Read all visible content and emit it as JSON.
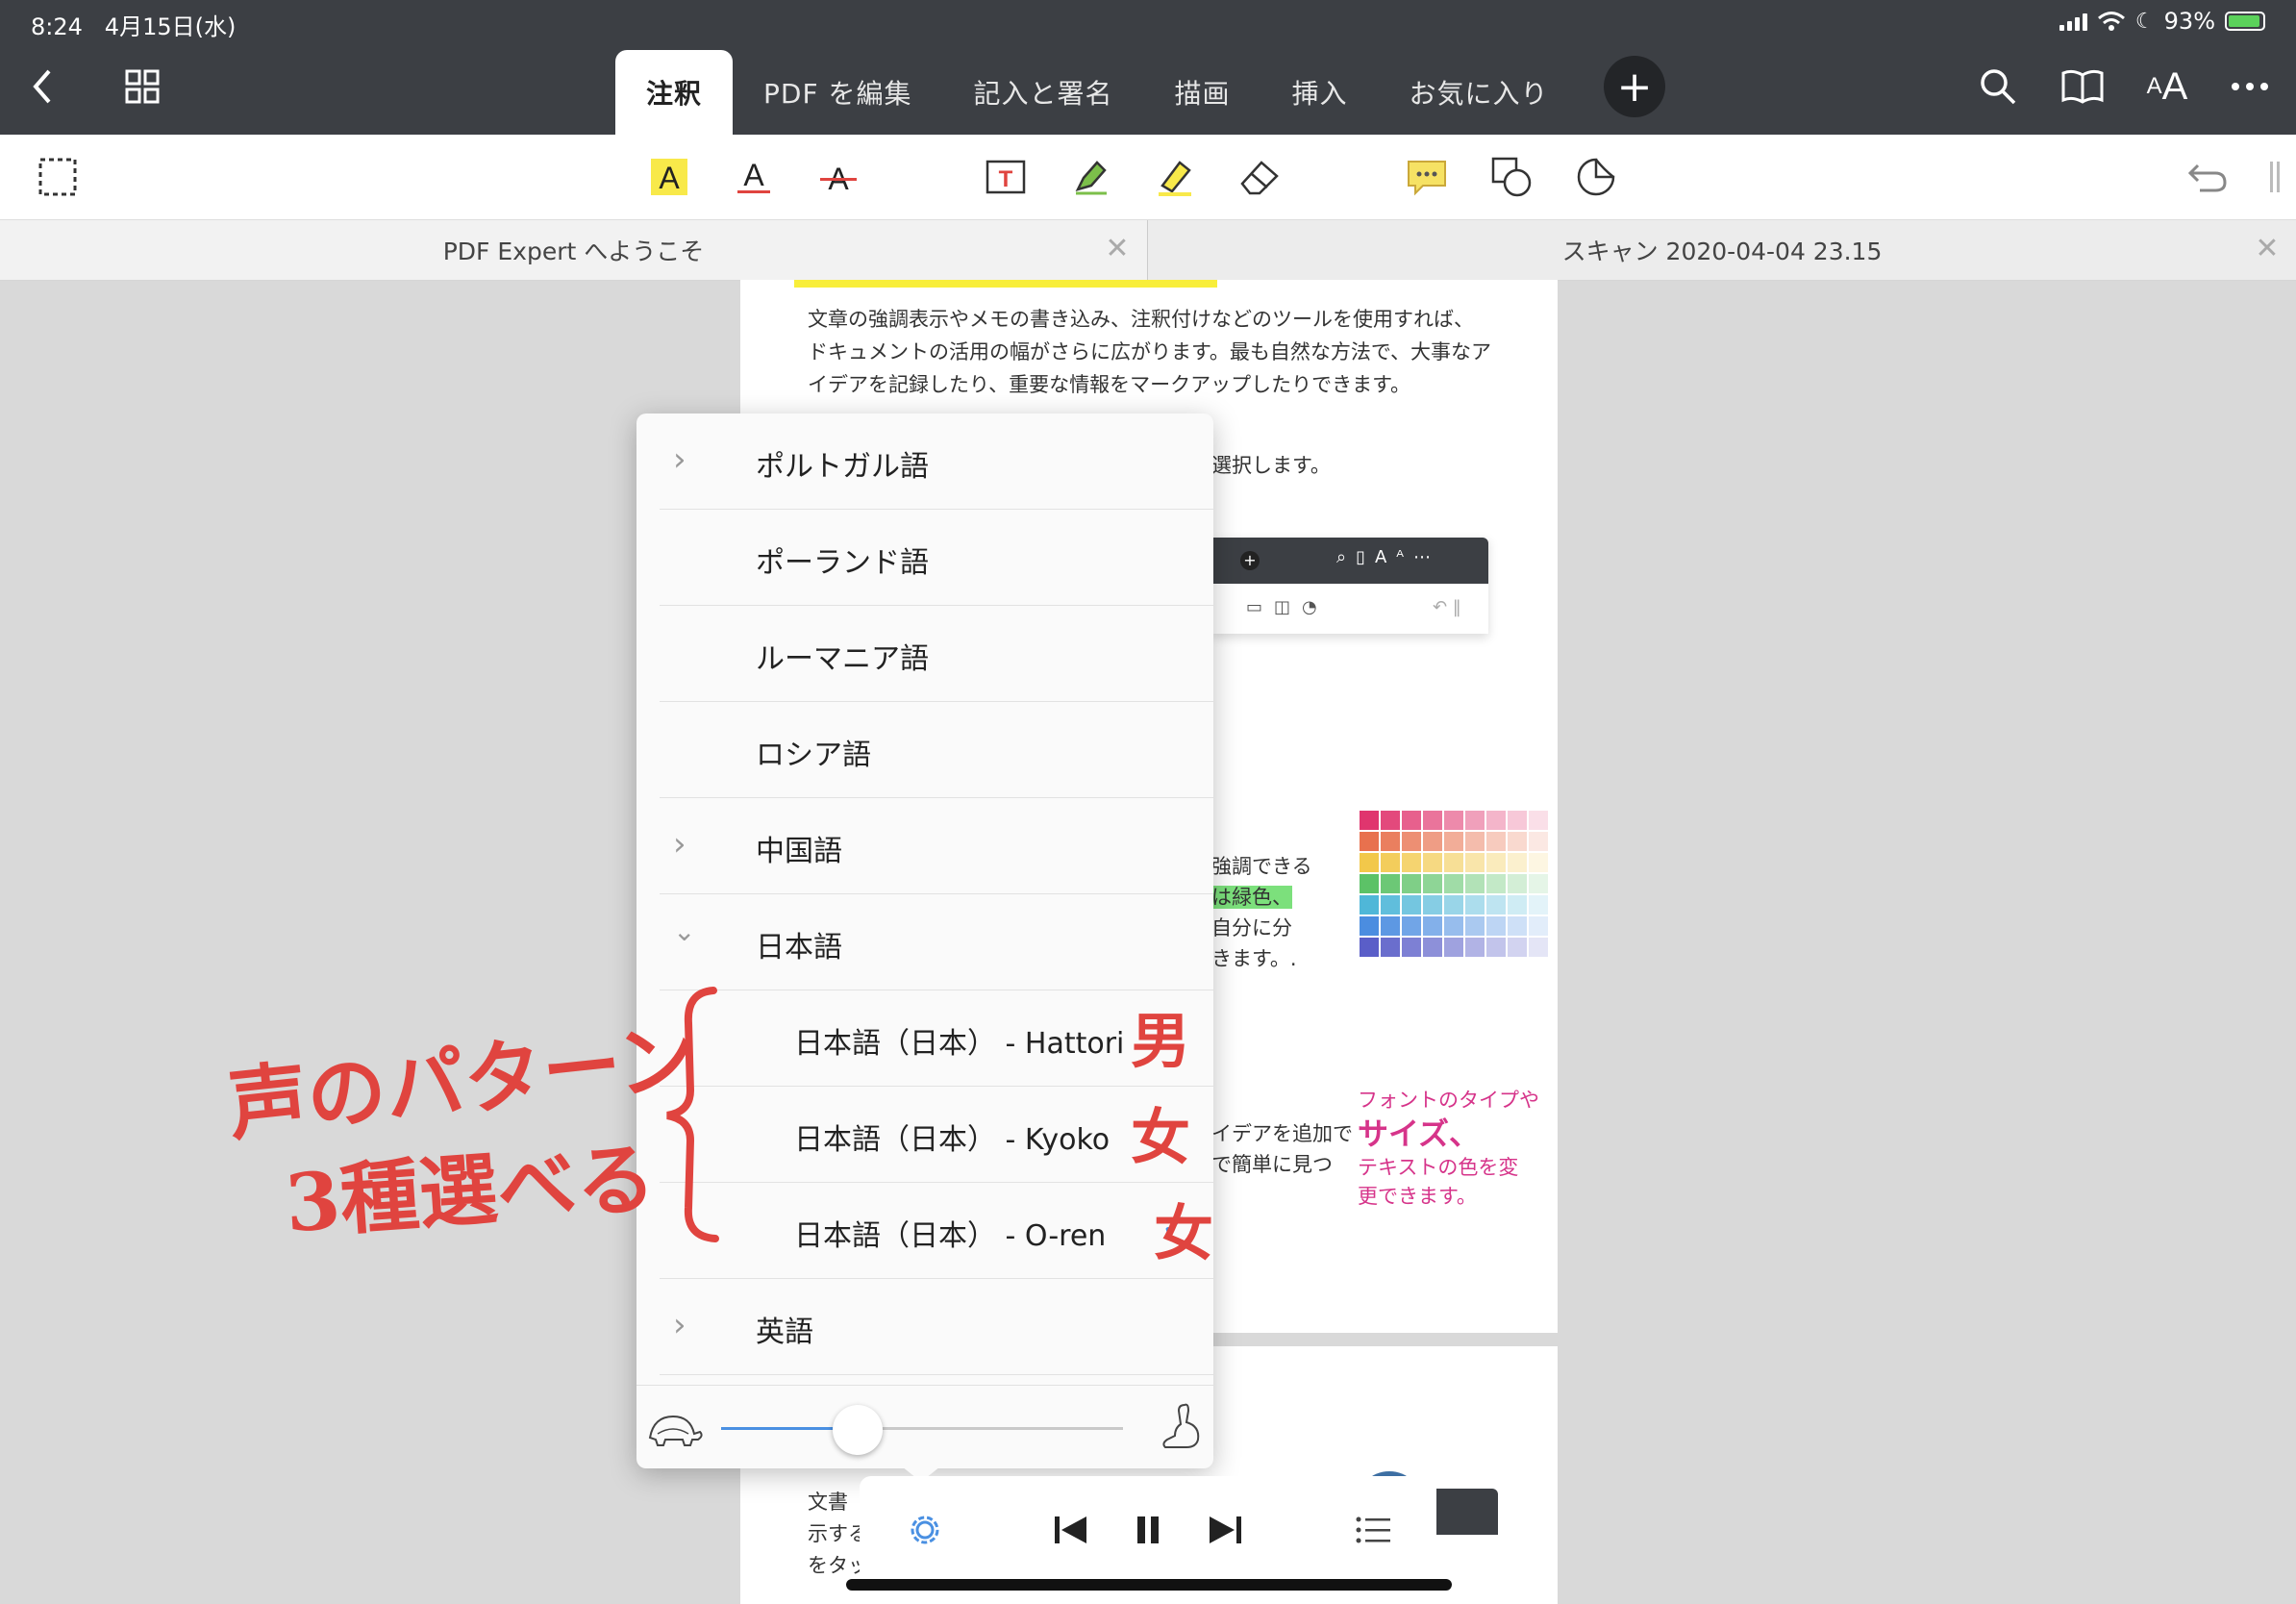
{
  "status_bar": {
    "time": "8:24",
    "date": "4月15日(水)",
    "battery": "93%",
    "battery_level": 0.93
  },
  "nav": {
    "tabs": [
      {
        "label": "注釈",
        "active": true
      },
      {
        "label": "PDF を編集"
      },
      {
        "label": "記入と署名"
      },
      {
        "label": "描画"
      },
      {
        "label": "挿入"
      },
      {
        "label": "お気に入り"
      }
    ]
  },
  "doc_tabs": [
    {
      "title": "PDF Expert へようこそ"
    },
    {
      "title": "スキャン 2020-04-04 23.15"
    }
  ],
  "page": {
    "paragraph": [
      "文章の強調表示やメモの書き込み、注釈付けなどのツールを使用すれば、",
      "ドキュメントの活用の幅がさらに広がります。最も自然な方法で、大事なア",
      "イデアを記録したり、重要な情報をマークアップしたりできます。"
    ],
    "snippet_select": "選択します。",
    "snippet_colors": [
      "強調できる",
      "は緑色、",
      "自分に分",
      "きます。."
    ],
    "snippet_add": [
      "イデアを追加で",
      "で簡単に見つ"
    ],
    "font_note_1": "フォントのタイプや",
    "font_note_2": "サイズ、",
    "font_note_3": "テキストの色を変",
    "font_note_4": "更できます。",
    "page2_lines": [
      "文書",
      "示する",
      "をタッ"
    ]
  },
  "language_list": [
    {
      "label": "ポルトガル語",
      "chevron": "right"
    },
    {
      "label": "ポーランド語"
    },
    {
      "label": "ルーマニア語"
    },
    {
      "label": "ロシア語"
    },
    {
      "label": "中国語",
      "chevron": "right"
    },
    {
      "label": "日本語",
      "chevron": "down"
    },
    {
      "label": "日本語（日本） - Hattori",
      "sub": true
    },
    {
      "label": "日本語（日本） - Kyoko",
      "sub": true
    },
    {
      "label": "日本語（日本） - O-ren",
      "sub": true,
      "selected": true
    },
    {
      "label": "英語",
      "chevron": "right"
    }
  ],
  "speed_slider": {
    "value": 0.34
  },
  "annotation": {
    "line1": "声のパターン",
    "line2": "3種選べる",
    "male": "男",
    "female1": "女",
    "female2": "女"
  },
  "colors": {
    "accent": "#4a90e2",
    "nav_bg": "#3c3f44",
    "annotation": "#e0443f"
  }
}
